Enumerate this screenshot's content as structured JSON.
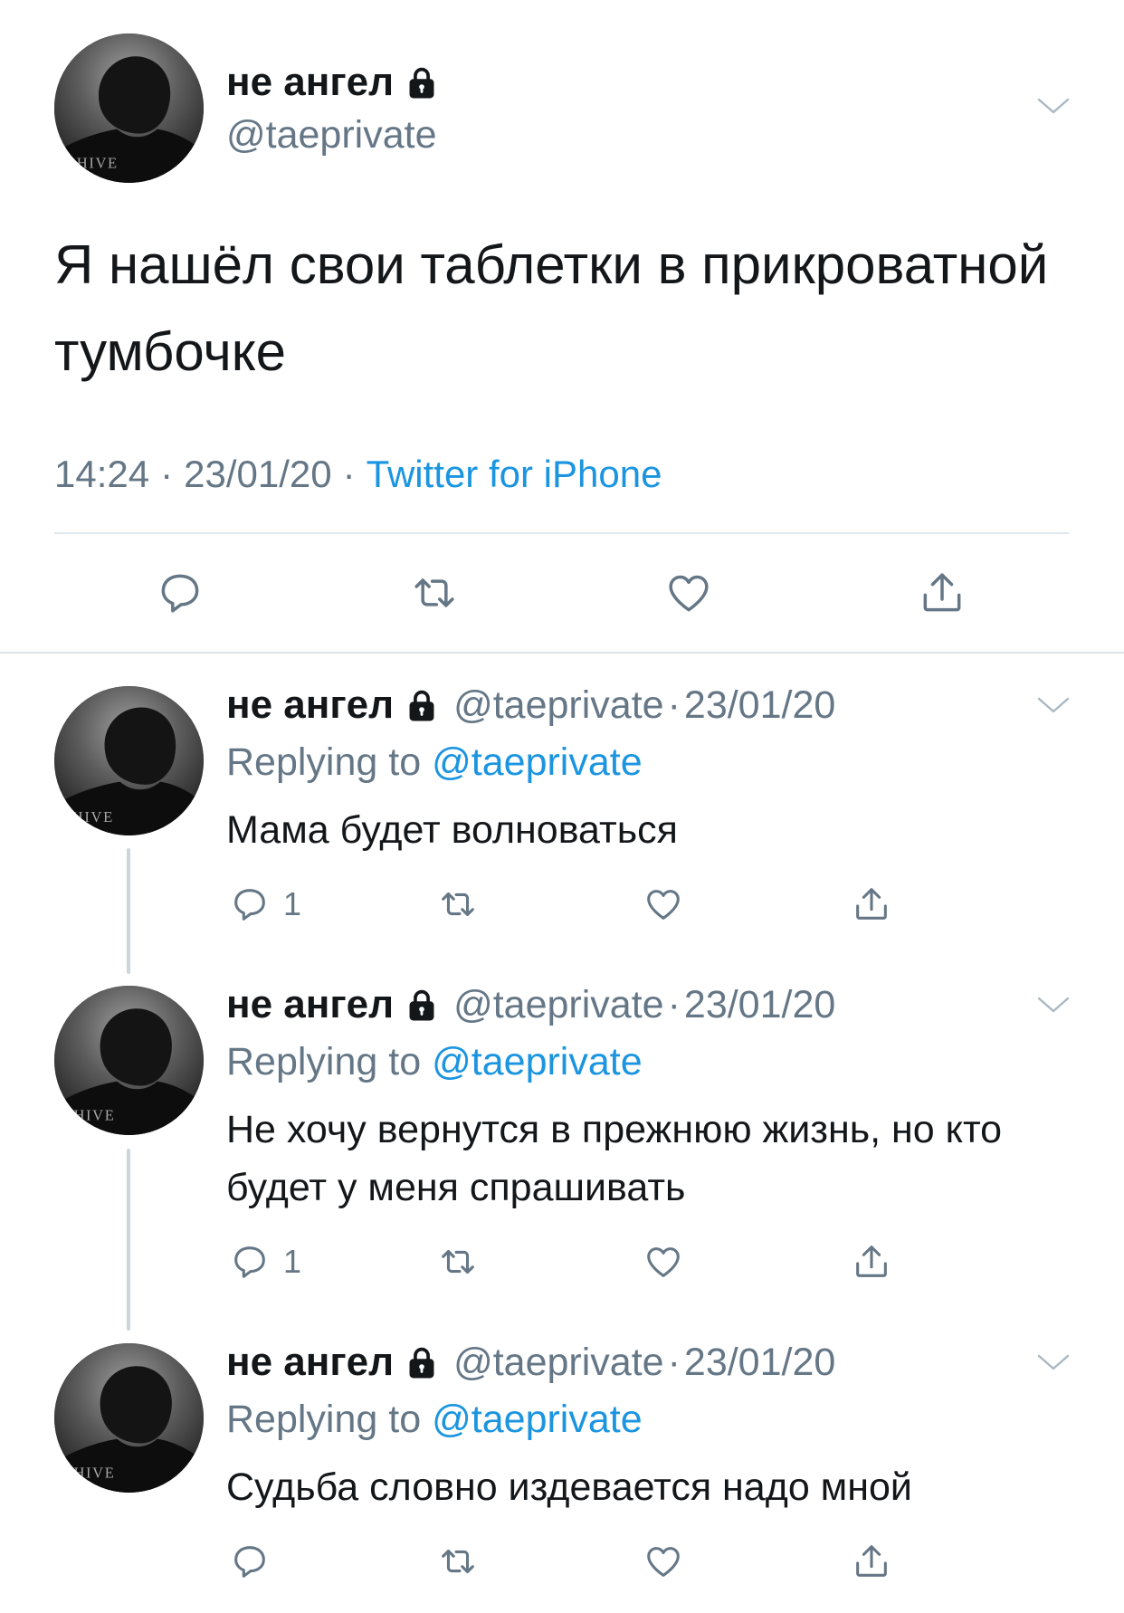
{
  "main_tweet": {
    "author": {
      "name": "не ангел",
      "handle": "@taeprivate",
      "avatar_watermark": "HIVE"
    },
    "text": "Я нашёл свои таблетки в прикроватной тумбочке",
    "time": "14:24",
    "date": "23/01/20",
    "source": "Twitter for iPhone"
  },
  "separator": "·",
  "replies": [
    {
      "name": "не ангел",
      "handle": "@taeprivate",
      "date": "23/01/20",
      "replying_label": "Replying to",
      "replying_to": "@taeprivate",
      "text": "Мама будет волноваться",
      "reply_count": "1"
    },
    {
      "name": "не ангел",
      "handle": "@taeprivate",
      "date": "23/01/20",
      "replying_label": "Replying to",
      "replying_to": "@taeprivate",
      "text": "Не хочу вернутся в прежнюю жизнь, но кто будет у меня спрашивать",
      "reply_count": "1"
    },
    {
      "name": "не ангел",
      "handle": "@taeprivate",
      "date": "23/01/20",
      "replying_label": "Replying to",
      "replying_to": "@taeprivate",
      "text": "Судьба словно издевается надо мной"
    }
  ],
  "icons": {
    "protected": "lock-icon",
    "menu": "chevron-down-icon",
    "reply": "reply-icon",
    "retweet": "retweet-icon",
    "like": "heart-icon",
    "share": "share-icon"
  },
  "colors": {
    "text": "#14171a",
    "secondary": "#657786",
    "link": "#1b95e0",
    "divider": "#e1e8ed",
    "thread_line": "#ccd6dd"
  }
}
